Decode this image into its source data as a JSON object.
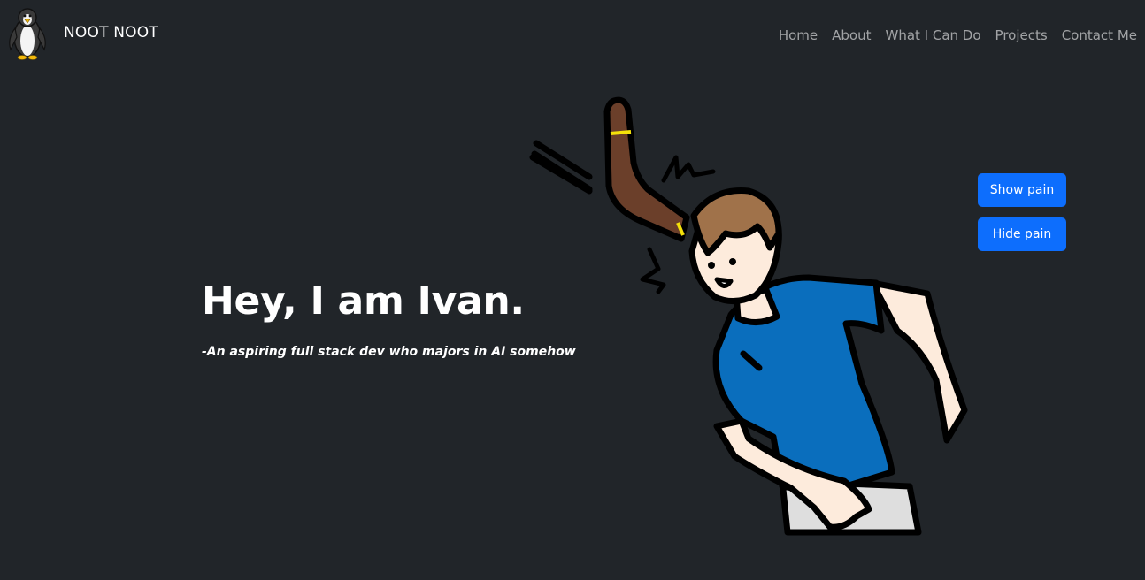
{
  "navbar": {
    "brand_text": "NOOT NOOT",
    "brand_icon": "penguin-logo",
    "links": [
      {
        "label": "Home"
      },
      {
        "label": "About"
      },
      {
        "label": "What I Can Do"
      },
      {
        "label": "Projects"
      },
      {
        "label": "Contact Me"
      }
    ]
  },
  "hero": {
    "title": "Hey, I am Ivan.",
    "subtitle": "-An aspiring full stack dev who majors in AI somehow",
    "illustration": "boomerang-hitting-head-illustration"
  },
  "buttons": {
    "show_label": "Show pain",
    "hide_label": "Hide pain"
  },
  "colors": {
    "background": "#212529",
    "primary": "#0d6efd",
    "shirt": "#0a6ebd",
    "hair": "#a0724a",
    "boomerang": "#6b3f2a",
    "skin": "#fdebdc"
  }
}
